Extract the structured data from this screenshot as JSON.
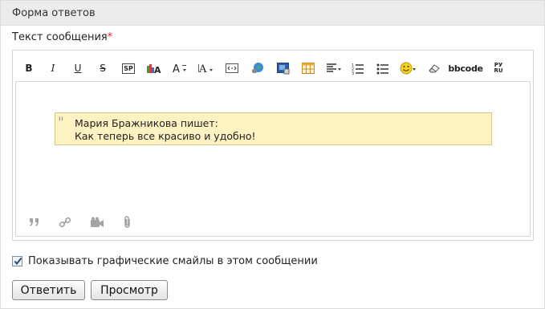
{
  "header": {
    "title": "Форма ответов"
  },
  "message": {
    "label": "Текст сообщения",
    "required_mark": "*"
  },
  "toolbar": {
    "bold": "B",
    "italic": "I",
    "underline": "U",
    "strike": "S",
    "spoiler": "SP",
    "bbcode": "bbcode",
    "translit_top": "РУ",
    "translit_bottom": "RU"
  },
  "quote": {
    "author_line": "Мария Бражникова пишет:",
    "text": "Как теперь все красиво и удобно!"
  },
  "smiles_option": {
    "label": "Показывать графические смайлы в этом сообщении",
    "checked": true
  },
  "buttons": {
    "reply": "Ответить",
    "preview": "Просмотр"
  },
  "colors": {
    "accent_required": "#e0202a",
    "quote_background": "#fff2c2"
  }
}
